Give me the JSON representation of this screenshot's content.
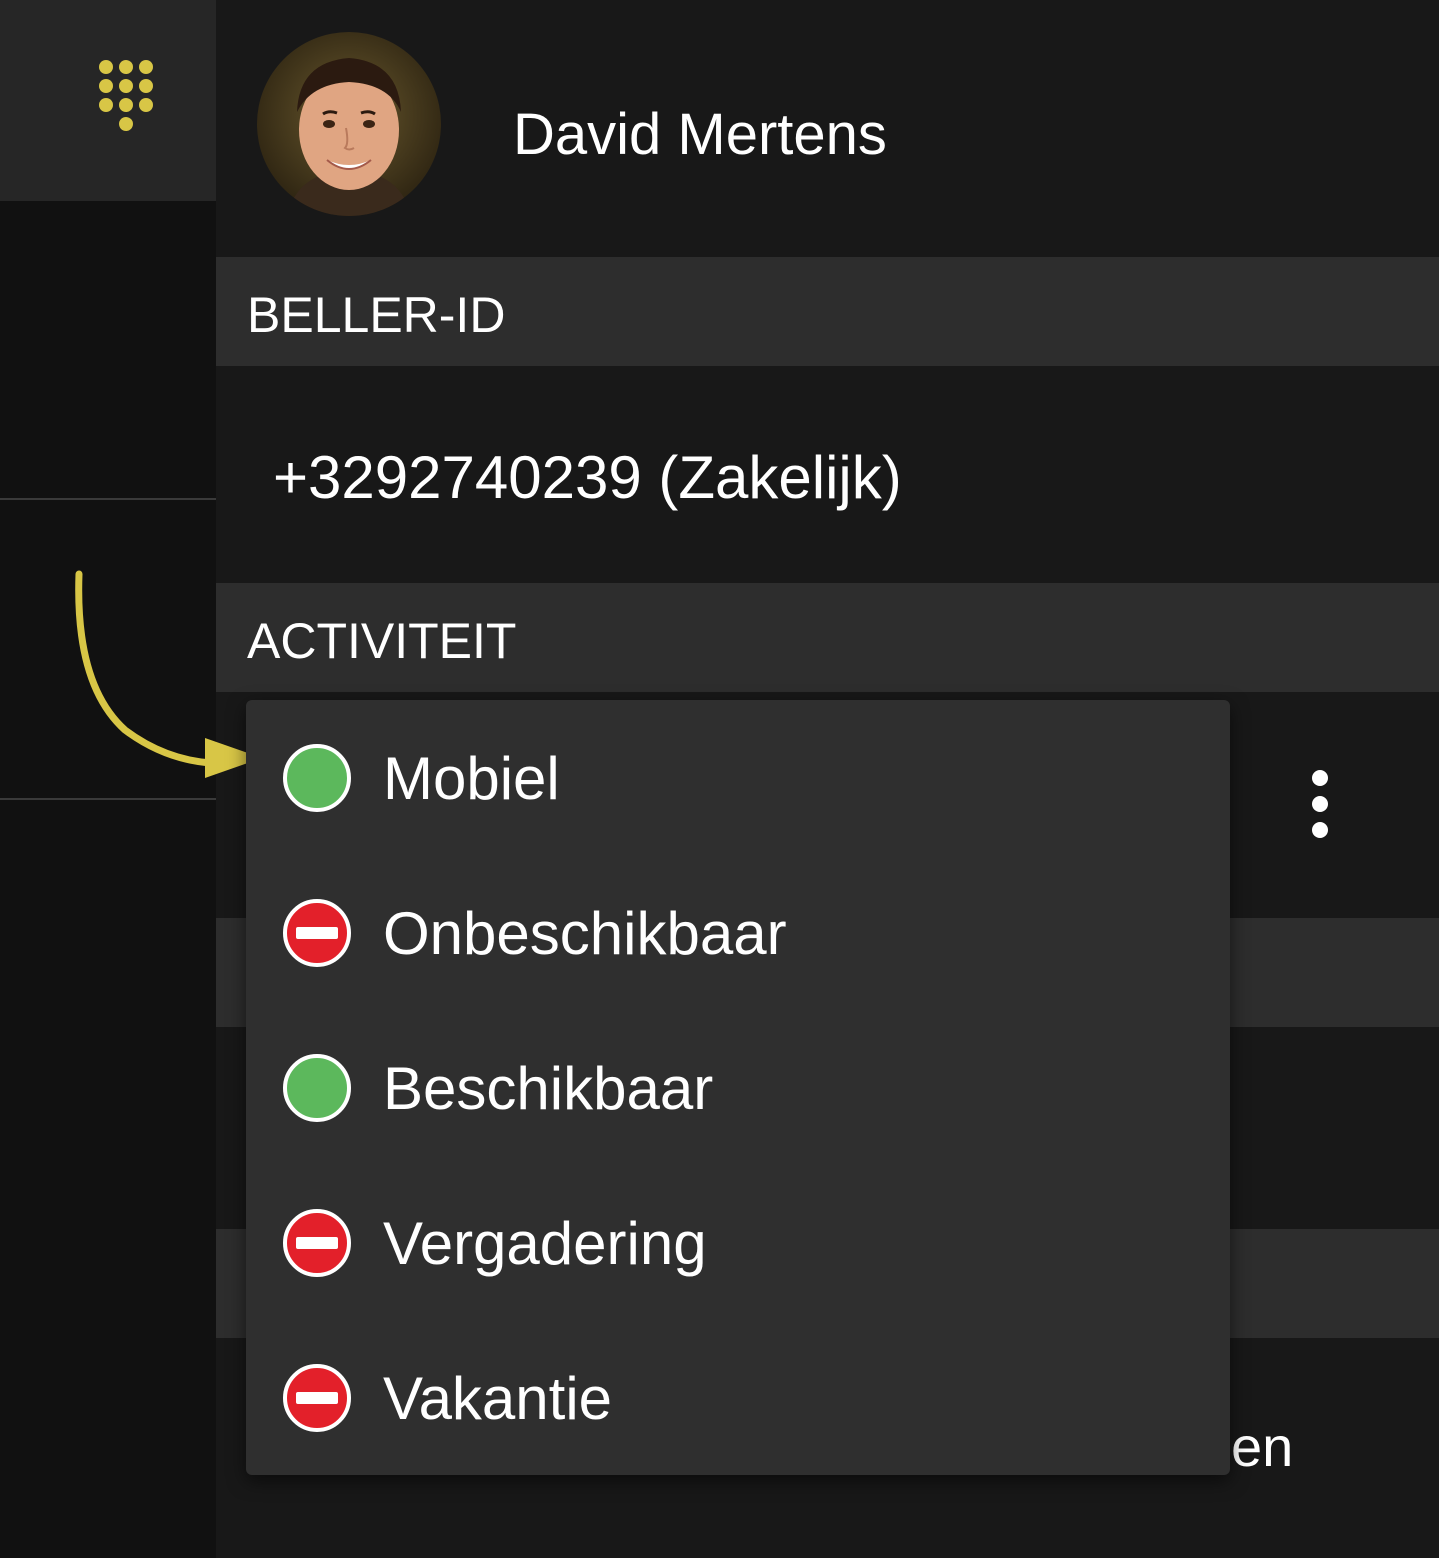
{
  "contact": {
    "name": "David Mertens",
    "avatar": "avatar-photo"
  },
  "sections": {
    "caller_id": {
      "header": "BELLER-ID",
      "number": "+3292740239 (Zakelijk)"
    },
    "activity": {
      "header": "ACTIVITEIT"
    }
  },
  "background_partial_text": "en",
  "icons": {
    "dialpad": "dialpad-icon",
    "more": "more-vertical-icon",
    "available": "green-dot-icon",
    "unavailable": "red-no-entry-icon",
    "annotation": "curved-arrow-icon"
  },
  "status_menu": {
    "options": [
      {
        "label": "Mobiel",
        "status": "available"
      },
      {
        "label": "Onbeschikbaar",
        "status": "unavailable"
      },
      {
        "label": "Beschikbaar",
        "status": "available"
      },
      {
        "label": "Vergadering",
        "status": "unavailable"
      },
      {
        "label": "Vakantie",
        "status": "unavailable"
      }
    ]
  },
  "colors": {
    "accent_yellow": "#D8C646",
    "available_green": "#5CB85C",
    "unavailable_red": "#E3202A",
    "background": "#181818",
    "section_header": "#2D2D2D",
    "menu_background": "#2F2F2F"
  }
}
